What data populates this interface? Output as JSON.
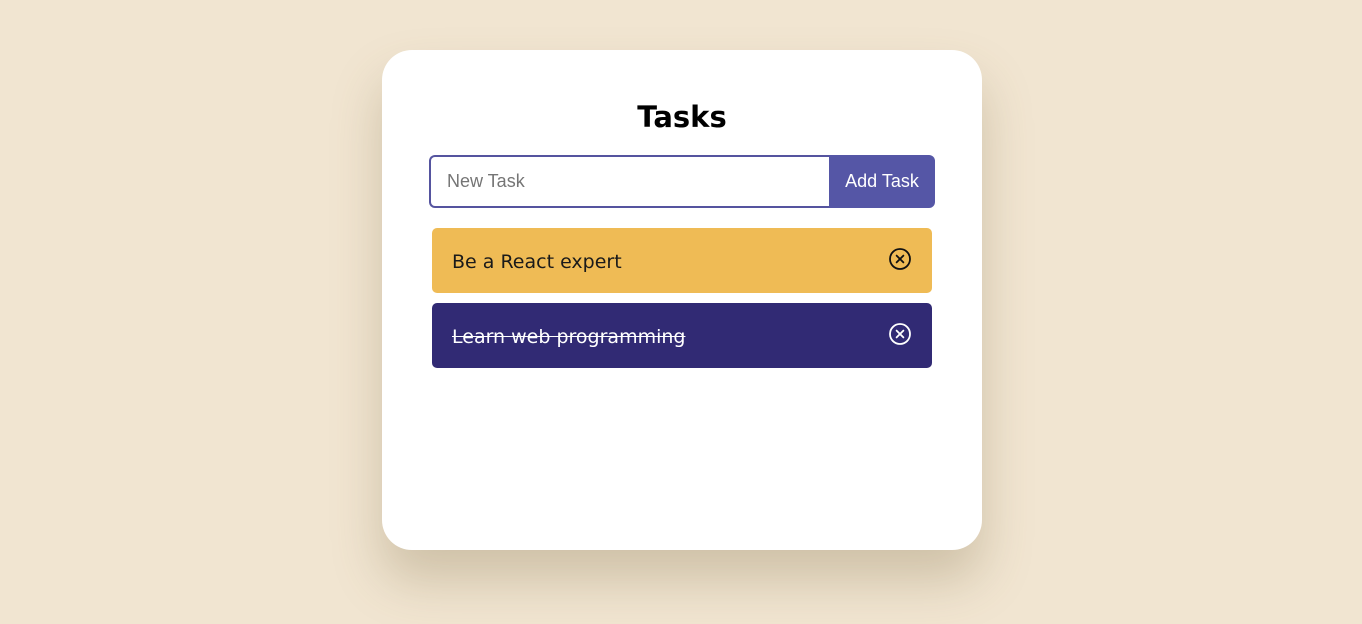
{
  "app": {
    "title": "Tasks"
  },
  "form": {
    "input_placeholder": "New Task",
    "input_value": "",
    "add_label": "Add Task"
  },
  "tasks": [
    {
      "label": "Be a React expert",
      "completed": false,
      "bg_color": "#efbb55",
      "text_color": "#1a1a1a",
      "icon": "close-circle-icon"
    },
    {
      "label": "Learn web programming",
      "completed": true,
      "bg_color": "#312a74",
      "text_color": "#ffffff",
      "icon": "close-circle-icon"
    }
  ],
  "colors": {
    "page_bg": "#f1e5d1",
    "card_bg": "#ffffff",
    "accent": "#5556a6"
  }
}
